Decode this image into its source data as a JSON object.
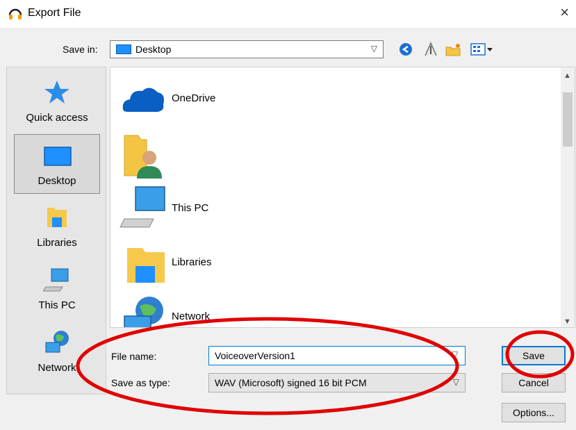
{
  "window": {
    "title": "Export File",
    "close_glyph": "×"
  },
  "toolbar": {
    "save_in_label": "Save in:",
    "save_in_value": "Desktop",
    "icons": [
      "back-icon",
      "up-folder-icon",
      "new-folder-icon",
      "view-menu-icon"
    ]
  },
  "places": [
    {
      "label": "Quick access",
      "icon": "star-icon"
    },
    {
      "label": "Desktop",
      "icon": "desktop-icon",
      "selected": true
    },
    {
      "label": "Libraries",
      "icon": "libraries-icon"
    },
    {
      "label": "This PC",
      "icon": "computer-icon"
    },
    {
      "label": "Network",
      "icon": "network-icon"
    }
  ],
  "files": [
    {
      "name": "OneDrive",
      "icon": "cloud-icon"
    },
    {
      "name": "",
      "icon": "user-folder-icon"
    },
    {
      "name": "This PC",
      "icon": "computer-icon"
    },
    {
      "name": "Libraries",
      "icon": "libraries-icon"
    },
    {
      "name": "Network",
      "icon": "network-icon"
    }
  ],
  "form": {
    "file_name_label": "File name:",
    "file_name_value": "VoiceoverVersion1",
    "save_as_type_label": "Save as type:",
    "save_as_type_value": "WAV (Microsoft) signed 16 bit PCM"
  },
  "buttons": {
    "save": "Save",
    "cancel": "Cancel",
    "options": "Options..."
  },
  "colors": {
    "annotation": "#e00000",
    "accent": "#0078d7"
  }
}
